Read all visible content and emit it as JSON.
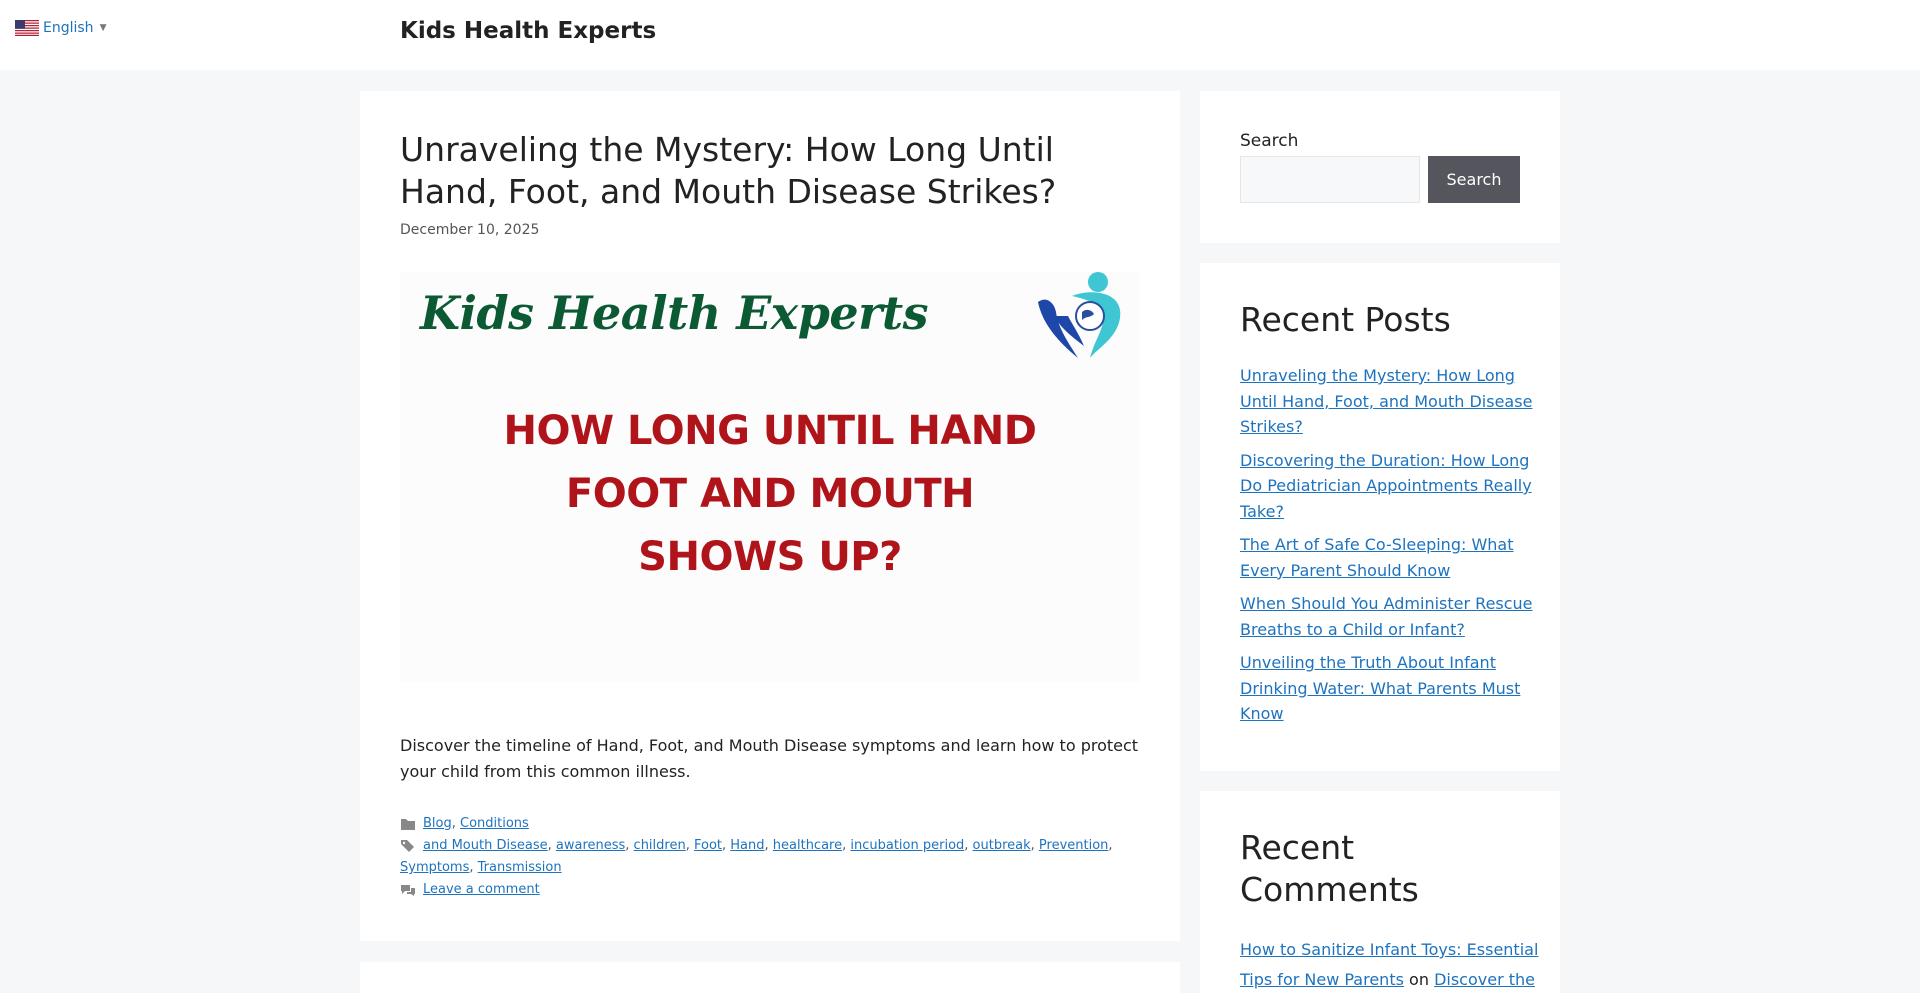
{
  "header": {
    "language": "English",
    "site_title": "Kids Health Experts"
  },
  "article": {
    "title": "Unraveling the Mystery: How Long Until Hand, Foot, and Mouth Disease Strikes?",
    "date": "December 10, 2025",
    "featured_image": {
      "brand": "Kids Health Experts",
      "headline_lines": [
        "HOW LONG UNTIL HAND",
        "FOOT AND MOUTH",
        "SHOWS UP?"
      ],
      "colors": {
        "brand": "#0b5a34",
        "headline": "#b0141b"
      }
    },
    "summary": "Discover the timeline of Hand, Foot, and Mouth Disease symptoms and learn how to protect your child from this common illness.",
    "categories": [
      "Blog",
      "Conditions"
    ],
    "tags": [
      "and Mouth Disease",
      "awareness",
      "children",
      "Foot",
      "Hand",
      "healthcare",
      "incubation period",
      "outbreak",
      "Prevention",
      "Symptoms",
      "Transmission"
    ],
    "comment_link": "Leave a comment"
  },
  "sidebar": {
    "search": {
      "label": "Search",
      "placeholder": "",
      "button": "Search"
    },
    "recent_posts": {
      "title": "Recent Posts",
      "items": [
        "Unraveling the Mystery: How Long Until Hand, Foot, and Mouth Disease Strikes?",
        "Discovering the Duration: How Long Do Pediatrician Appointments Really Take?",
        "The Art of Safe Co-Sleeping: What Every Parent Should Know",
        "When Should You Administer Rescue Breaths to a Child or Infant?",
        "Unveiling the Truth About Infant Drinking Water: What Parents Must Know"
      ]
    },
    "recent_comments": {
      "title": "Recent Comments",
      "first_comment": {
        "post": "How to Sanitize Infant Toys: Essential Tips for New Parents",
        "connector": "on",
        "author_link": "Discover the"
      }
    }
  },
  "theme": {
    "link_color": "#1e73be",
    "background": "#f6f7f8",
    "search_button_bg": "#55555e"
  }
}
